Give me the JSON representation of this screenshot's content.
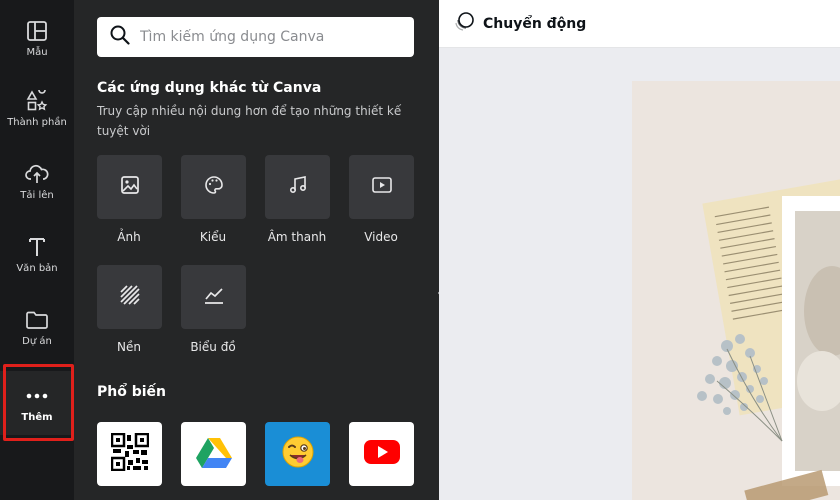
{
  "sidebar": {
    "items": [
      {
        "label": "Mẫu",
        "icon": "template-icon"
      },
      {
        "label": "Thành phần",
        "icon": "elements-icon"
      },
      {
        "label": "Tải lên",
        "icon": "upload-cloud-icon"
      },
      {
        "label": "Văn bản",
        "icon": "text-icon"
      },
      {
        "label": "Dự án",
        "icon": "folder-icon"
      },
      {
        "label": "Thêm",
        "icon": "more-dots-icon"
      }
    ],
    "active": "Thêm"
  },
  "search": {
    "placeholder": "Tìm kiếm ứng dụng Canva"
  },
  "more_apps": {
    "title": "Các ứng dụng khác từ Canva",
    "subtitle": "Truy cập nhiều nội dung hơn để tạo những thiết kế tuyệt vời",
    "apps": [
      {
        "label": "Ảnh",
        "icon": "photo-icon"
      },
      {
        "label": "Kiểu",
        "icon": "palette-icon"
      },
      {
        "label": "Âm thanh",
        "icon": "music-note-icon"
      },
      {
        "label": "Video",
        "icon": "video-play-icon"
      },
      {
        "label": "Nền",
        "icon": "background-stripes-icon"
      },
      {
        "label": "Biểu đồ",
        "icon": "chart-line-icon"
      }
    ]
  },
  "popular": {
    "title": "Phổ biến",
    "apps": [
      {
        "icon": "qr-code-icon"
      },
      {
        "icon": "google-drive-icon"
      },
      {
        "icon": "emoji-wink-icon"
      },
      {
        "icon": "youtube-icon"
      }
    ]
  },
  "toolbar": {
    "animate_label": "Chuyển động"
  },
  "colors": {
    "rail_bg": "#18191b",
    "panel_bg": "#252627",
    "tile_bg": "#38393c",
    "highlight": "#e0201b",
    "canvas_bg": "#ebecf0",
    "youtube_red": "#ff0000",
    "emoji_blue": "#1a8ed6"
  }
}
